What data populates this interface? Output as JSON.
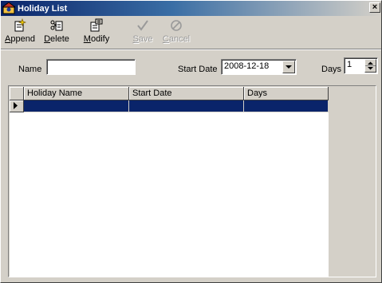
{
  "window": {
    "title": "Holiday List",
    "close_label": "×"
  },
  "toolbar": {
    "append": {
      "u": "A",
      "rest": "ppend",
      "icon": "append-icon"
    },
    "delete": {
      "u": "D",
      "rest": "elete",
      "icon": "delete-icon"
    },
    "modify": {
      "u": "M",
      "rest": "odify",
      "icon": "modify-icon"
    },
    "save": {
      "u": "S",
      "rest": "ave",
      "icon": "checkmark-icon",
      "disabled": true
    },
    "cancel": {
      "u": "C",
      "rest": "ancel",
      "icon": "cancel-icon",
      "disabled": true
    }
  },
  "form": {
    "name_label": "Name",
    "name_value": "",
    "start_date_label": "Start Date",
    "start_date_value": "2008-12-18",
    "days_label": "Days",
    "days_value": "1"
  },
  "grid": {
    "columns": [
      "Holiday Name",
      "Start Date",
      "Days"
    ],
    "rows": [
      {
        "holiday_name": "",
        "start_date": "",
        "days": "",
        "selected": true
      }
    ]
  },
  "colors": {
    "title_bar": "#0a246a",
    "selection": "#0a246a",
    "face": "#d4d0c8"
  }
}
